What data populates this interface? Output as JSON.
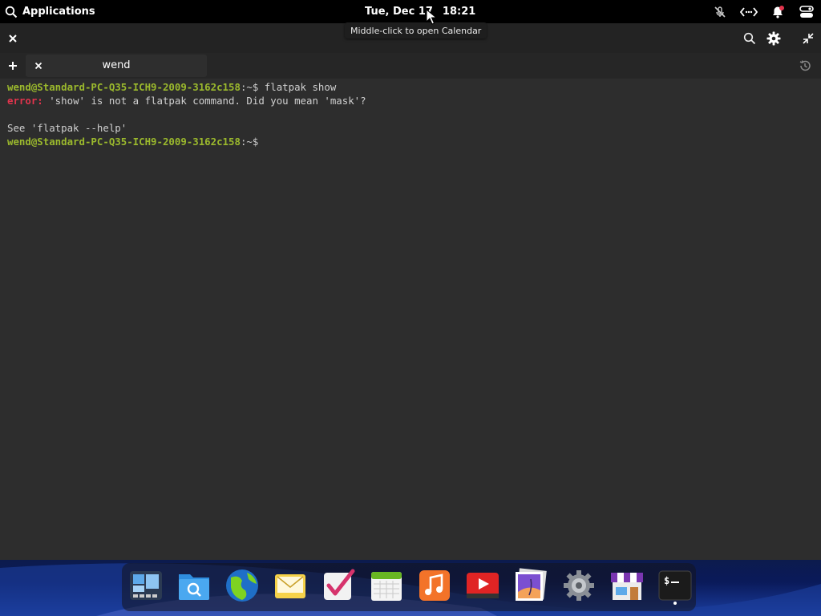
{
  "topbar": {
    "applications_label": "Applications",
    "date": "Tue, Dec 17",
    "time": "18:21",
    "indicators": [
      "microphone-muted-icon",
      "network-wired-icon",
      "notifications-icon",
      "power-toggle-icon"
    ]
  },
  "tooltip": {
    "text": "Middle-click to open Calendar"
  },
  "tab": {
    "label": "wend"
  },
  "terminal": {
    "line1_user": "wend@Standard-PC-Q35-ICH9-2009-3162c158",
    "line1_path": ":~$",
    "line1_cmd": " flatpak show",
    "line2_err": "error:",
    "line2_msg": " 'show' is not a flatpak command. Did you mean 'mask'?",
    "line3": "",
    "line4": "See 'flatpak --help'",
    "line5_user": "wend@Standard-PC-Q35-ICH9-2009-3162c158",
    "line5_path": ":~$"
  },
  "dock": {
    "apps": [
      "Multitasking View",
      "Files",
      "Web",
      "Mail",
      "Tasks",
      "Calendar",
      "Music",
      "Videos",
      "Photos",
      "System Settings",
      "AppCenter",
      "Terminal"
    ]
  },
  "colors": {
    "prompt_green": "#9bb92d",
    "error_red": "#e2344d",
    "background": "#2d2d2d",
    "notification_badge": "#e2344d"
  }
}
